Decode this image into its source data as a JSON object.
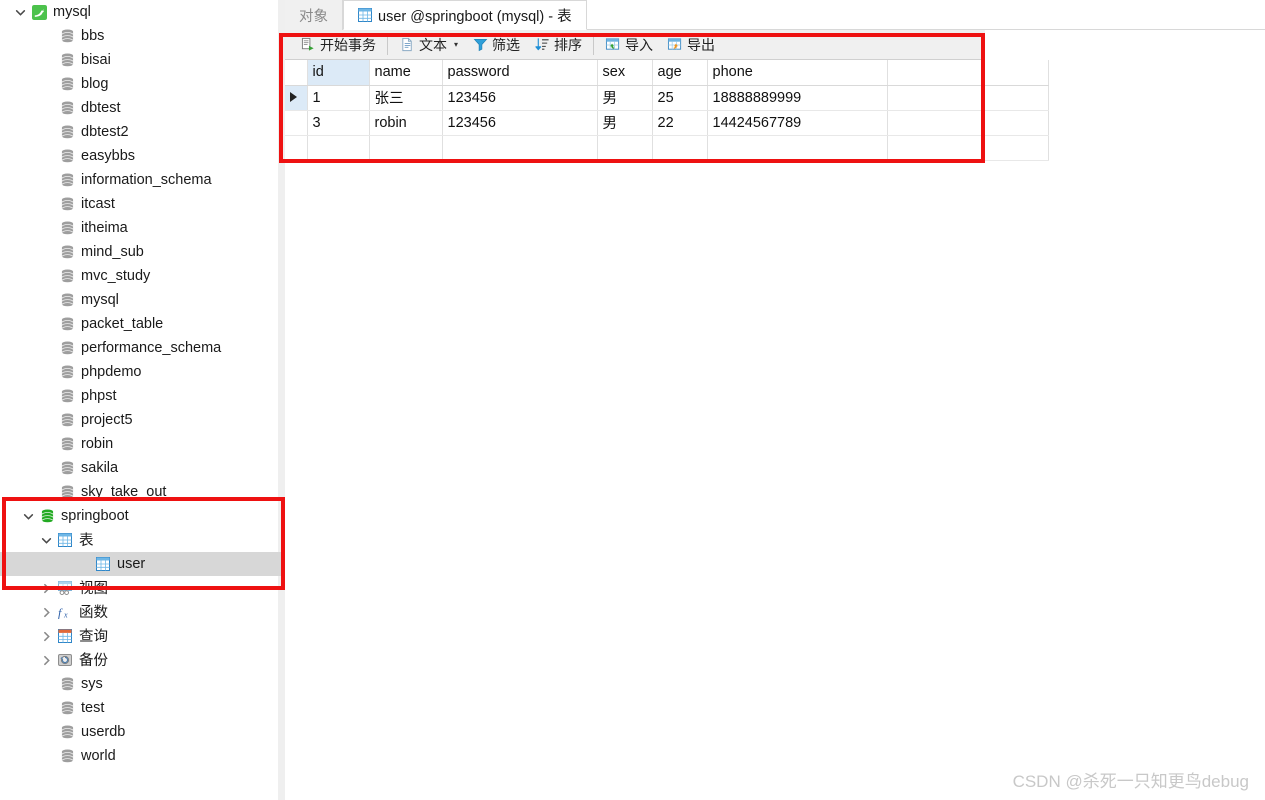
{
  "sidebar": {
    "connection": {
      "label": "mysql",
      "icon": "mysql-dolphin-icon",
      "expanded": true
    },
    "databases": [
      {
        "label": "bbs"
      },
      {
        "label": "bisai"
      },
      {
        "label": "blog"
      },
      {
        "label": "dbtest"
      },
      {
        "label": "dbtest2"
      },
      {
        "label": "easybbs"
      },
      {
        "label": "information_schema"
      },
      {
        "label": "itcast"
      },
      {
        "label": "itheima"
      },
      {
        "label": "mind_sub"
      },
      {
        "label": "mvc_study"
      },
      {
        "label": "mysql"
      },
      {
        "label": "packet_table"
      },
      {
        "label": "performance_schema"
      },
      {
        "label": "phpdemo"
      },
      {
        "label": "phpst"
      },
      {
        "label": "project5"
      },
      {
        "label": "robin"
      },
      {
        "label": "sakila"
      },
      {
        "label": "sky_take_out"
      }
    ],
    "active_database": {
      "label": "springboot",
      "expanded": true,
      "connected": true
    },
    "active_database_children": [
      {
        "label": "表",
        "icon": "table-grid-icon",
        "expanded": true,
        "has_twisty": true
      },
      {
        "label": "视图",
        "icon": "view-icon",
        "expanded": false,
        "has_twisty": true
      },
      {
        "label": "函数",
        "icon": "function-fx-icon",
        "expanded": false,
        "has_twisty": true
      },
      {
        "label": "查询",
        "icon": "query-icon",
        "expanded": false,
        "has_twisty": true
      },
      {
        "label": "备份",
        "icon": "backup-icon",
        "expanded": false,
        "has_twisty": true
      }
    ],
    "selected_table": {
      "label": "user",
      "icon": "table-grid-icon",
      "selected": true
    },
    "databases_after": [
      {
        "label": "sys"
      },
      {
        "label": "test"
      },
      {
        "label": "userdb"
      },
      {
        "label": "world"
      }
    ]
  },
  "tabs": [
    {
      "label": "对象",
      "active": false,
      "icon": null
    },
    {
      "label": "user @springboot (mysql) - 表",
      "active": true,
      "icon": "table-grid-icon"
    }
  ],
  "toolbar": {
    "begin_transaction": "开始事务",
    "text": "文本",
    "filter": "筛选",
    "sort": "排序",
    "import": "导入",
    "export": "导出"
  },
  "grid": {
    "columns": [
      "id",
      "name",
      "password",
      "sex",
      "age",
      "phone",
      ""
    ],
    "current_column": "id",
    "rows": [
      {
        "current": true,
        "id": "1",
        "name": "张三",
        "password": "123456",
        "sex": "男",
        "age": "25",
        "phone": "18888889999",
        "extra": ""
      },
      {
        "current": false,
        "id": "3",
        "name": "robin",
        "password": "123456",
        "sex": "男",
        "age": "22",
        "phone": "14424567789",
        "extra": ""
      }
    ]
  },
  "watermark": "CSDN @杀死一只知更鸟debug",
  "colors": {
    "highlight_box": "#ee1111",
    "selection": "#d7d7d7",
    "current_column": "#dceaf7",
    "db_connected": "#22aa22",
    "db_closed": "#9e9e9e",
    "toolbar_bg": "#f0f0f0"
  }
}
